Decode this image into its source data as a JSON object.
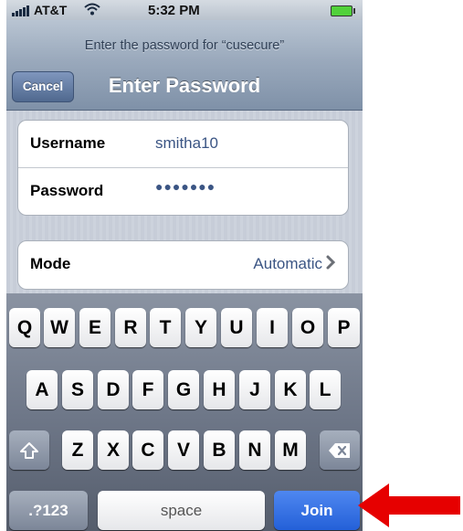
{
  "status_bar": {
    "carrier": "AT&T",
    "time": "5:32 PM"
  },
  "nav": {
    "prompt": "Enter the password for “cusecure”",
    "cancel_label": "Cancel",
    "title": "Enter Password"
  },
  "credentials": {
    "username_label": "Username",
    "username_value": "smitha10",
    "password_label": "Password",
    "password_mask": "●●●●●●●"
  },
  "mode": {
    "label": "Mode",
    "value": "Automatic"
  },
  "keyboard": {
    "row1": [
      "Q",
      "W",
      "E",
      "R",
      "T",
      "Y",
      "U",
      "I",
      "O",
      "P"
    ],
    "row2": [
      "A",
      "S",
      "D",
      "F",
      "G",
      "H",
      "J",
      "K",
      "L"
    ],
    "row3": [
      "Z",
      "X",
      "C",
      "V",
      "B",
      "N",
      "M"
    ],
    "numbers_label": ".?123",
    "space_label": "space",
    "join_label": "Join"
  },
  "colors": {
    "accent_blue": "#2460d8",
    "arrow_red": "#e60000",
    "value_blue": "#3b5584"
  }
}
